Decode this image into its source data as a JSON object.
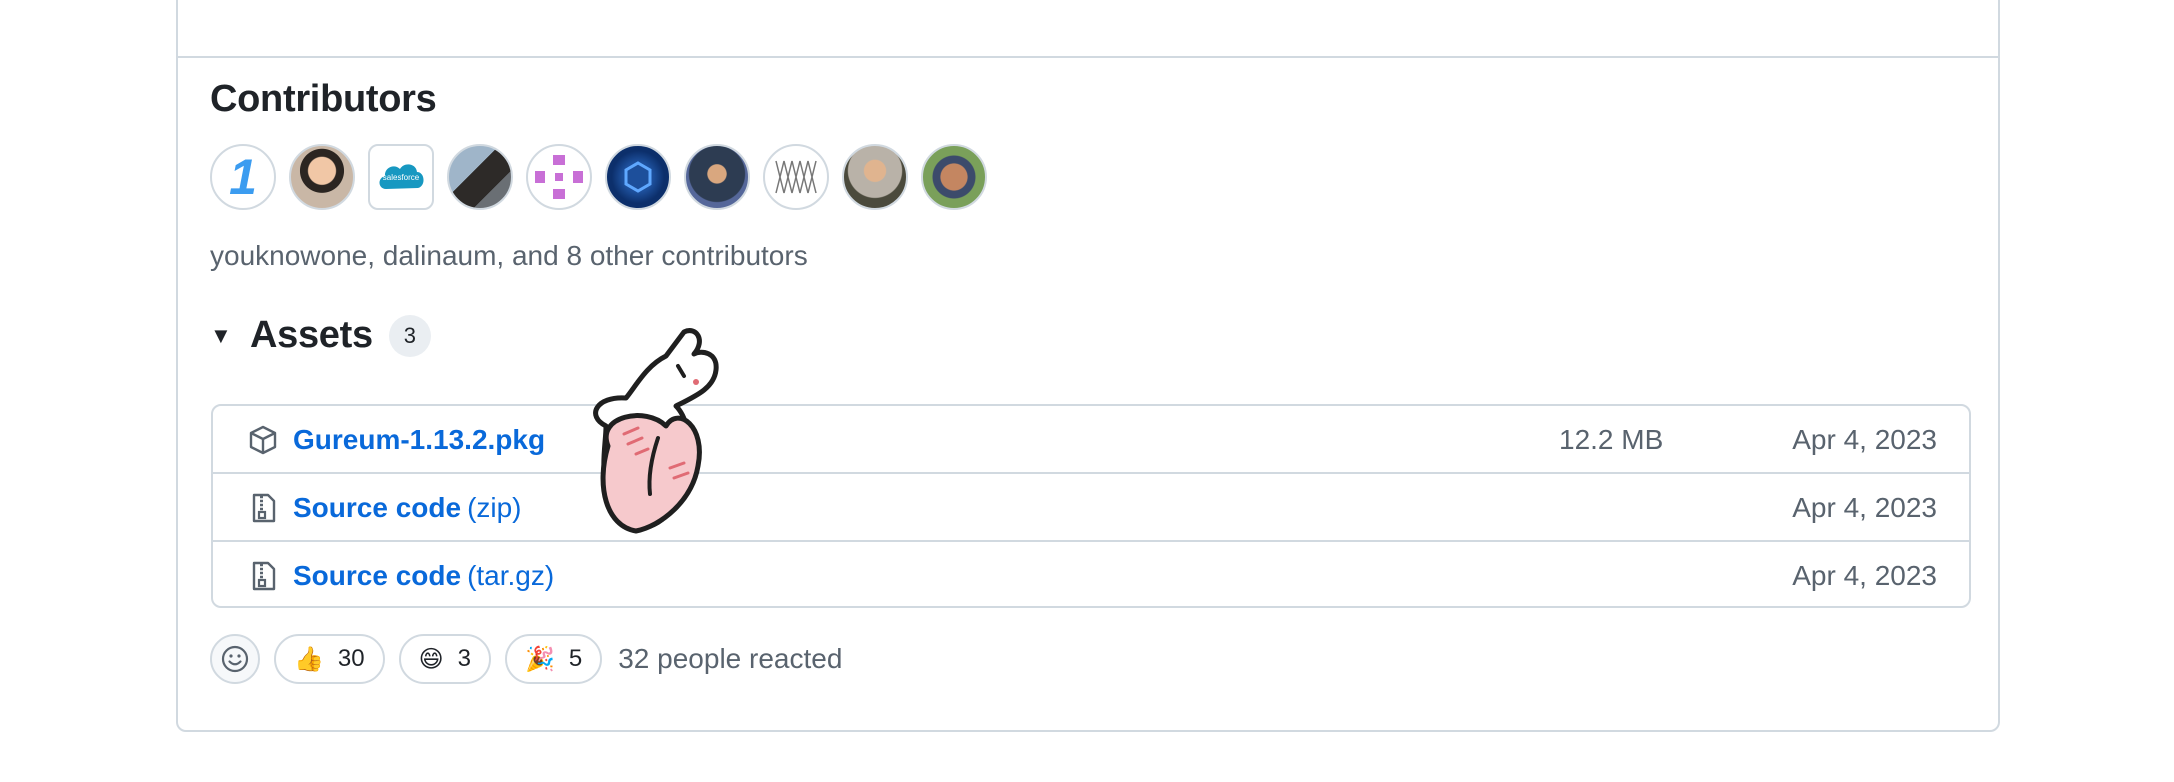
{
  "contributors": {
    "title": "Contributors",
    "summary": "youknowone, dalinaum, and 8 other contributors",
    "avatar_badge_text": "1",
    "salesforce_logo_text": "salesforce"
  },
  "assets": {
    "title": "Assets",
    "count": "3",
    "items": [
      {
        "name": "Gureum-1.13.2.pkg",
        "ext": "",
        "size": "12.2 MB",
        "date": "Apr 4, 2023",
        "icon": "package-icon"
      },
      {
        "name": "Source code",
        "ext": "(zip)",
        "size": "",
        "date": "Apr 4, 2023",
        "icon": "file-zip-icon"
      },
      {
        "name": "Source code",
        "ext": "(tar.gz)",
        "size": "",
        "date": "Apr 4, 2023",
        "icon": "file-zip-icon"
      }
    ]
  },
  "reactions": {
    "items": [
      {
        "emoji": "👍",
        "count": "30"
      },
      {
        "emoji": "😄",
        "count": "3"
      },
      {
        "emoji": "🎉",
        "count": "5"
      }
    ],
    "summary": "32 people reacted"
  }
}
